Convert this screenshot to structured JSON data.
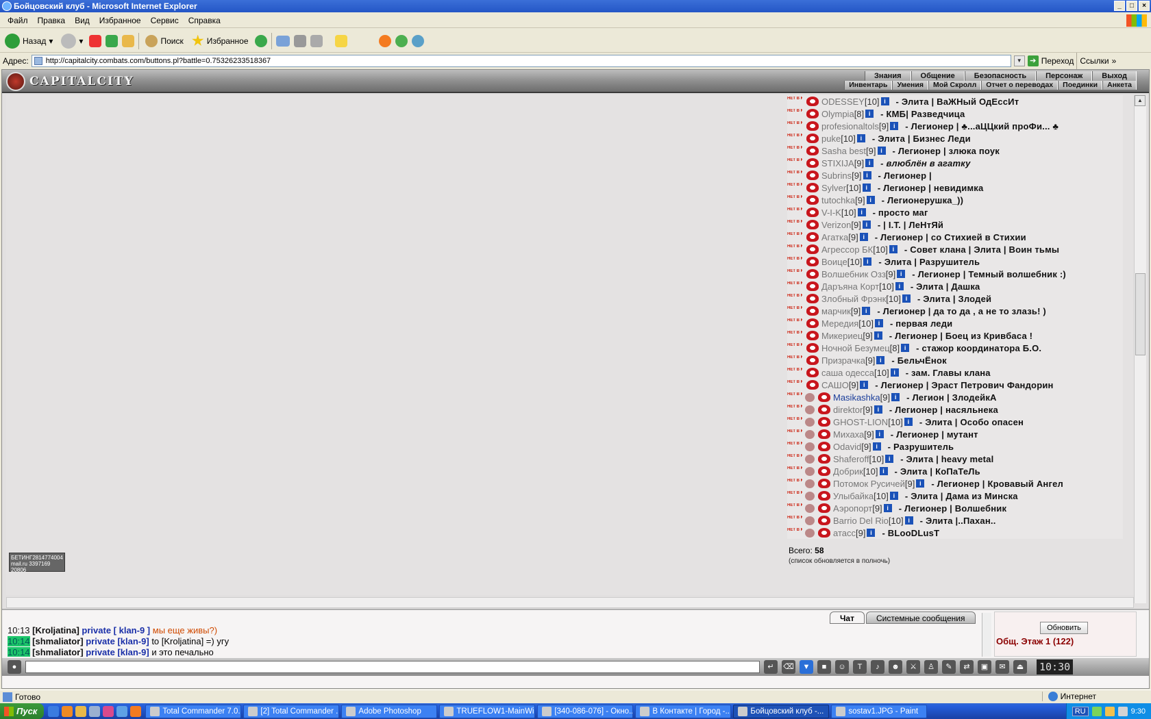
{
  "window": {
    "title": "Бойцовский клуб - Microsoft Internet Explorer"
  },
  "menu": [
    "Файл",
    "Правка",
    "Вид",
    "Избранное",
    "Сервис",
    "Справка"
  ],
  "toolbar": {
    "back": "Назад",
    "search": "Поиск",
    "favorites": "Избранное"
  },
  "address": {
    "label": "Адрес:",
    "url": "http://capitalcity.combats.com/buttons.pl?battle=0.75326233518367",
    "go": "Переход",
    "links": "Ссылки"
  },
  "site": {
    "logo": "CAPITALCITY",
    "nav_top": [
      "Знания",
      "Общение",
      "Безопасность",
      "Персонаж",
      "Выход"
    ],
    "nav_bottom": [
      "Инвентарь",
      "Умения",
      "Мой Скролл",
      "Отчет о переводах",
      "Поединки",
      "Анкета"
    ],
    "counter": "БЕТИНГ2814774004 mail.ru 3397169 20806"
  },
  "users": [
    {
      "nick": "ODESSEY",
      "level": "[10]",
      "status": "- Элита | ВаЖНый ОдЕссИт"
    },
    {
      "nick": "Olympia",
      "level": "[8]",
      "status": "- КМБ| Разведчица"
    },
    {
      "nick": "profesionaltols",
      "level": "[9]",
      "status": "- Легионер | ♣...аЦЦкий проФи... ♣"
    },
    {
      "nick": "puke",
      "level": "[10]",
      "status": "- Элита | Бизнес Леди"
    },
    {
      "nick": "Sasha best",
      "level": "[9]",
      "status": "- Легионер | злюка поук"
    },
    {
      "nick": "STIXIJA",
      "level": "[9]",
      "status": "- влюблён в агатку",
      "italic": true
    },
    {
      "nick": "Subrins",
      "level": "[9]",
      "status": "- Легионер |"
    },
    {
      "nick": "Sylver",
      "level": "[10]",
      "status": "- Легионер | невидимка"
    },
    {
      "nick": "tutochka",
      "level": "[9]",
      "status": "- Легионерушка_))"
    },
    {
      "nick": "V-I-K",
      "level": "[10]",
      "status": "- просто маг"
    },
    {
      "nick": "Verizon",
      "level": "[9]",
      "status": "- | I.T. | ЛеНтЯй"
    },
    {
      "nick": "Агатка",
      "level": "[9]",
      "status": "- Легионер | со Стихией в Стихии"
    },
    {
      "nick": "Агрессор БК",
      "level": "[10]",
      "status": "- Совет клана | Элита | Воин тьмы"
    },
    {
      "nick": "Воице",
      "level": "[10]",
      "status": "- Элита | Разрушитель"
    },
    {
      "nick": "Волшебник Озз",
      "level": "[9]",
      "status": "- Легионер | Темный волшебник :)"
    },
    {
      "nick": "Даръяна Корт",
      "level": "[10]",
      "status": "- Элита | Дашка"
    },
    {
      "nick": "Злобный Фрэнк",
      "level": "[10]",
      "status": "- Элита | Злодей"
    },
    {
      "nick": "марчик",
      "level": "[9]",
      "status": "- Легионер | да то да , а не то злазь! )"
    },
    {
      "nick": "Мередия",
      "level": "[10]",
      "status": "- первая леди"
    },
    {
      "nick": "Микериец",
      "level": "[9]",
      "status": "- Легионер | Боец из Кривбаса !"
    },
    {
      "nick": "Ночной Безумец",
      "level": "[8]",
      "status": "- стажор координатора Б.О."
    },
    {
      "nick": "Призрачка",
      "level": "[9]",
      "status": "- БельчЁнок"
    },
    {
      "nick": "саша одесса",
      "level": "[10]",
      "status": "- зам. Главы клана"
    },
    {
      "nick": "САШО",
      "level": "[9]",
      "status": "- Легионер | Эраст Петрович Фандорин"
    },
    {
      "nick": "Masikashka",
      "level": "[9]",
      "status": "- Легион | ЗлодейкА",
      "online": true,
      "clan": true
    },
    {
      "nick": "direktor",
      "level": "[9]",
      "status": "- Легионер | насяльнека",
      "clan": true
    },
    {
      "nick": "GHOST-LION",
      "level": "[10]",
      "status": "- Элита | Особо опасен",
      "clan": true
    },
    {
      "nick": "Михаха",
      "level": "[9]",
      "status": "- Легионер | мутант",
      "clan": true
    },
    {
      "nick": "Odavid",
      "level": "[9]",
      "status": "- Разрушитель",
      "clan": true
    },
    {
      "nick": "Shaferoff",
      "level": "[10]",
      "status": "- Элита | heavy metal",
      "clan": true
    },
    {
      "nick": "Добрик",
      "level": "[10]",
      "status": "- Элита | КоПаТеЛь",
      "clan": true
    },
    {
      "nick": "Потомок Русичей",
      "level": "[9]",
      "status": "- Легионер | Кровавый Ангел",
      "clan": true
    },
    {
      "nick": "Улыбайка",
      "level": "[10]",
      "status": "- Элита | Дама из Минска",
      "clan": true
    },
    {
      "nick": "Аэропорт",
      "level": "[9]",
      "status": "- Легионер | Волшебник",
      "clan": true
    },
    {
      "nick": "Barrio Del Rio",
      "level": "[10]",
      "status": "- Элита |..Пахан..",
      "clan": true
    },
    {
      "nick": "атасс",
      "level": "[9]",
      "status": "- BLooDLusT",
      "clan": true
    }
  ],
  "userflag": "НЕТ В КЛУБЕ",
  "total": {
    "label": "Всего:",
    "count": "58",
    "note": "(список обновляется в полночь)"
  },
  "chat": {
    "tabs": [
      "Чат",
      "Системные сообщения"
    ],
    "lines": [
      {
        "time": "10:13",
        "from": "[Kroljatina]",
        "to": "private [ klan-9 ]",
        "msg": "мы еще живы?)",
        "hl": false,
        "orange": true
      },
      {
        "time": "10:14",
        "from": "[shmaliator]",
        "to": "private [klan-9]",
        "msg": "to [Kroljatina] =) угу",
        "hl": true,
        "orange": false
      },
      {
        "time": "10:14",
        "from": "[shmaliator]",
        "to": "private [klan-9]",
        "msg": "и это печально",
        "hl": true,
        "orange": false
      }
    ],
    "refresh": "Обновить",
    "room": "Общ. Этаж 1 (122)",
    "clock": "10:30"
  },
  "status": {
    "text": "Готово",
    "zone": "Интернет"
  },
  "taskbar": {
    "start": "Пуск",
    "tasks": [
      "Total Commander 7.0...",
      "[2] Total Commander ...",
      "Adobe Photoshop",
      "TRUEFLOW1-MainWin...",
      "[340-086-076] - Окно...",
      "В Контакте | Город -...",
      "Бойцовский клуб -...",
      "sostav1.JPG - Paint"
    ],
    "active_index": 6,
    "lang": "RU",
    "time": "9:30"
  }
}
